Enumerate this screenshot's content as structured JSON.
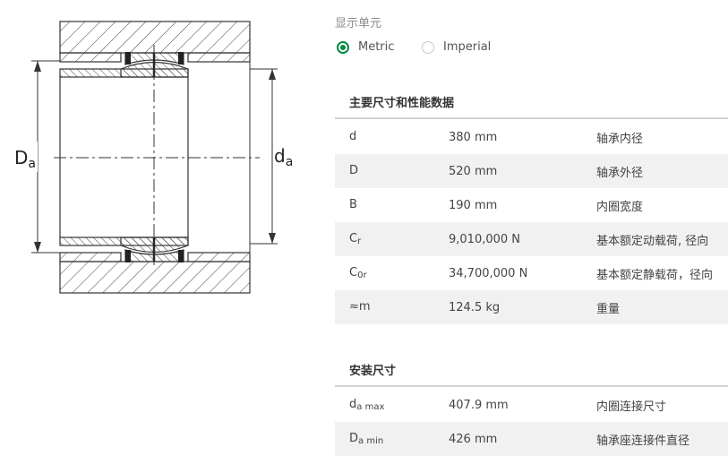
{
  "drawing": {
    "labels": {
      "Da": "D",
      "Da_sub": "a",
      "da": "d",
      "da_sub": "a"
    }
  },
  "units": {
    "label": "显示单元",
    "options": [
      {
        "label": "Metric",
        "selected": true
      },
      {
        "label": "Imperial",
        "selected": false
      }
    ]
  },
  "main_dimensions": {
    "title": "主要尺寸和性能数据",
    "rows": [
      {
        "symbol": "d",
        "sub": "",
        "value": "380 mm",
        "desc": "轴承内径"
      },
      {
        "symbol": "D",
        "sub": "",
        "value": "520 mm",
        "desc": "轴承外径"
      },
      {
        "symbol": "B",
        "sub": "",
        "value": "190 mm",
        "desc": "内圈宽度"
      },
      {
        "symbol": "C",
        "sub": "r",
        "value": "9,010,000 N",
        "desc": "基本额定动载荷, 径向"
      },
      {
        "symbol": "C",
        "sub": "0r",
        "value": "34,700,000 N",
        "desc": "基本额定静载荷，径向"
      },
      {
        "symbol": "≈m",
        "sub": "",
        "value": "124.5 kg",
        "desc": "重量"
      }
    ]
  },
  "mounting_dimensions": {
    "title": "安装尺寸",
    "rows": [
      {
        "symbol": "d",
        "sub": "a max",
        "value": "407.9 mm",
        "desc": "内圈连接尺寸"
      },
      {
        "symbol": "D",
        "sub": "a min",
        "value": "426 mm",
        "desc": "轴承座连接件直径"
      }
    ]
  },
  "colors": {
    "accent": "#00893d",
    "row_alt": "#f1f1f1",
    "rule": "#d2d2d2"
  }
}
